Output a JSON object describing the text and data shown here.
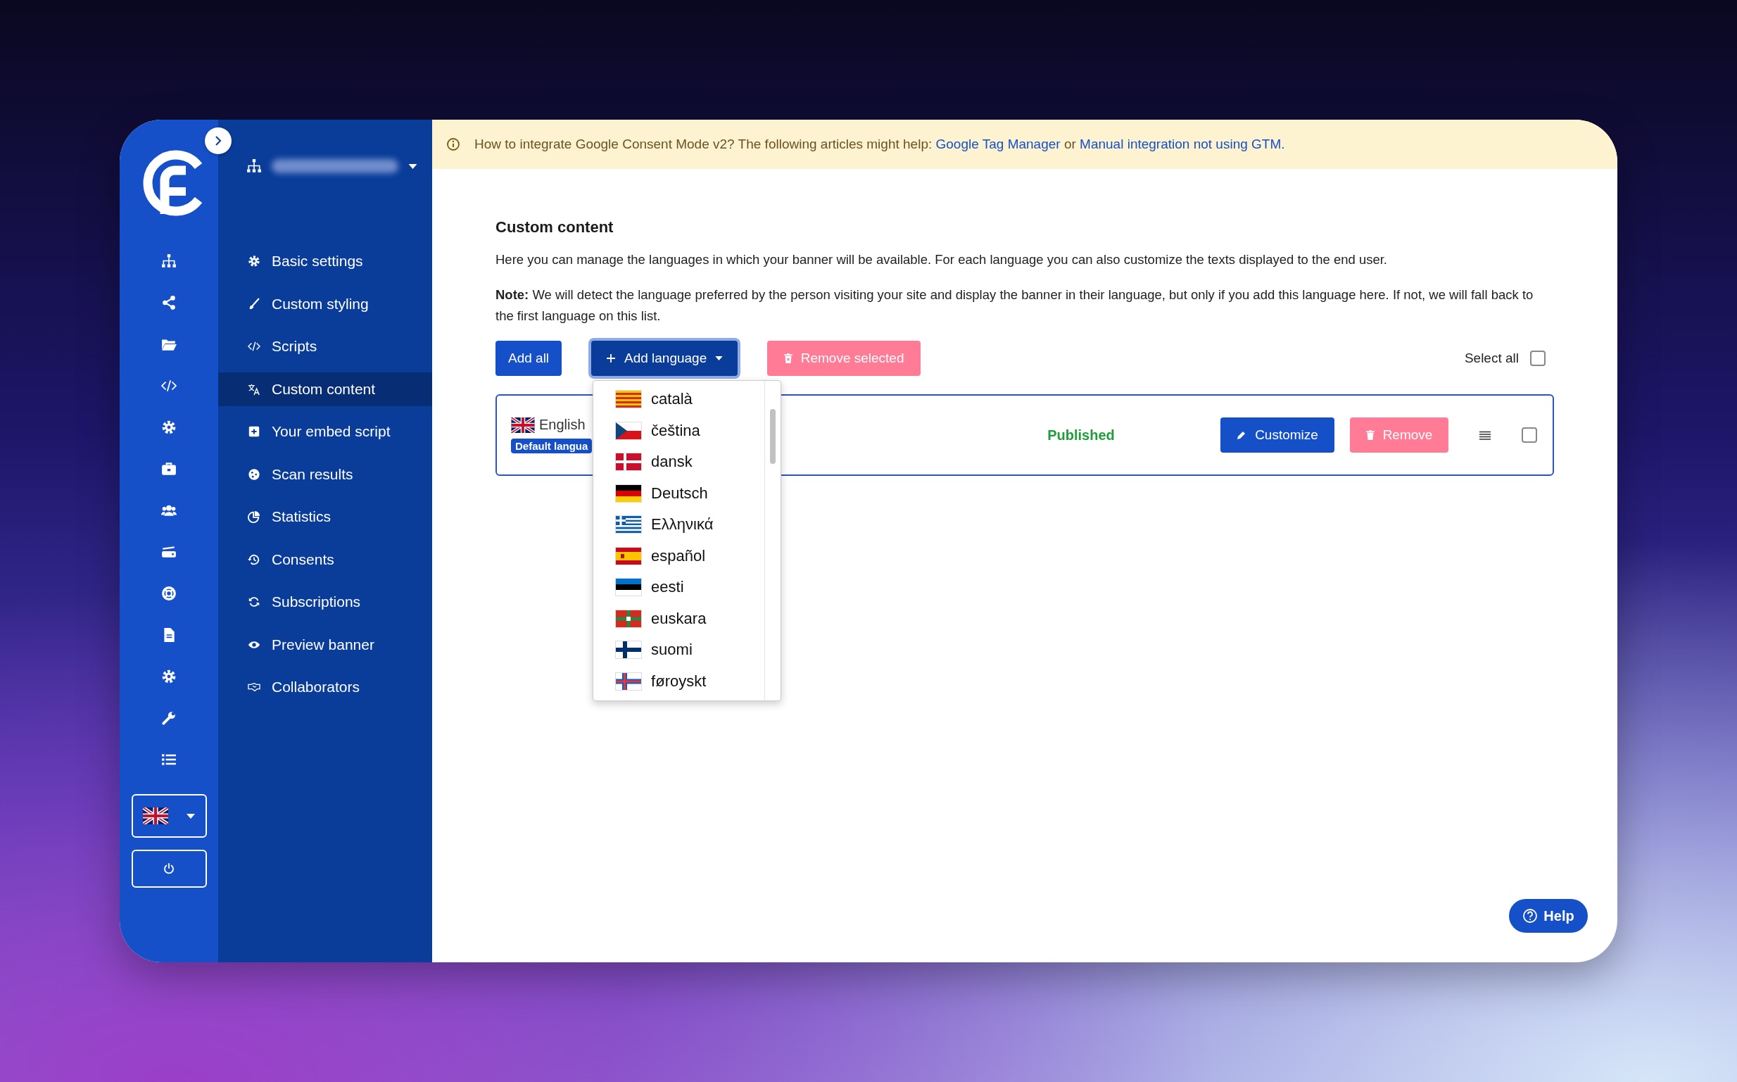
{
  "banner": {
    "parts": [
      {
        "kind": "text",
        "text": "How to integrate Google Consent Mode v2? The following articles might help: "
      },
      {
        "kind": "link",
        "text": "Google Tag Manager"
      },
      {
        "kind": "text",
        "text": " or "
      },
      {
        "kind": "link",
        "text": "Manual integration not using GTM."
      }
    ]
  },
  "sidebar": {
    "items": [
      {
        "label": "Basic settings",
        "selected": false
      },
      {
        "label": "Custom styling",
        "selected": false
      },
      {
        "label": "Scripts",
        "selected": false
      },
      {
        "label": "Custom content",
        "selected": true
      },
      {
        "label": "Your embed script",
        "selected": false
      },
      {
        "label": "Scan results",
        "selected": false
      },
      {
        "label": "Statistics",
        "selected": false
      },
      {
        "label": "Consents",
        "selected": false
      },
      {
        "label": "Subscriptions",
        "selected": false
      },
      {
        "label": "Preview banner",
        "selected": false
      },
      {
        "label": "Collaborators",
        "selected": false
      }
    ]
  },
  "content": {
    "title": "Custom content",
    "description": "Here you can manage the languages in which your banner will be available. For each language you can also customize the texts displayed to the end user.",
    "note": "**Note:** We will detect the language preferred by the person visiting your site and display the banner in their language, but only if you add this language here. If not, we will fall back to the first language on this list."
  },
  "actions": [
    {
      "kind": "primary",
      "label": "Add all"
    },
    {
      "kind": "dropdown",
      "label": "Add language",
      "expanded": true
    },
    {
      "kind": "danger",
      "label": "Remove selected"
    }
  ],
  "select_all": {
    "label": "Select all",
    "checked": false
  },
  "language_dropdown": {
    "options": [
      "català",
      "čeština",
      "dansk",
      "Deutsch",
      "Ελληνικά",
      "español",
      "eesti",
      "euskara",
      "suomi",
      "føroyskt"
    ]
  },
  "languages": [
    {
      "name": "English",
      "badge": "Default langua",
      "status": "Published",
      "customize": "Customize",
      "remove": "Remove",
      "checked": false
    }
  ],
  "help": {
    "label": "Help"
  }
}
